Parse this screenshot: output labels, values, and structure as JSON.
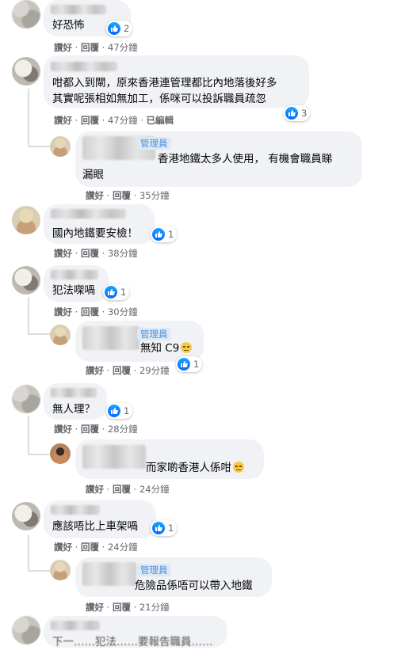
{
  "actions": {
    "like": "讚好",
    "reply": "回覆",
    "edited": "已編輯"
  },
  "admin_badge": "管理員",
  "comments": [
    {
      "text": "好恐怖",
      "likes": "2",
      "time": "47分鐘"
    },
    {
      "text_line1": "咁都入到閘，原來香港連管理都比內地落後好多",
      "text_line2": "其實呢張相如無加工，係咪可以投訴職員疏忽",
      "likes": "3",
      "time": "47分鐘"
    },
    {
      "text_line1": "香港地鐵太多人使用， 有機會職員睇",
      "text_line2": "漏眼",
      "time": "35分鐘"
    },
    {
      "text": "國內地鐵要安檢！",
      "likes": "1",
      "time": "38分鐘"
    },
    {
      "text": "犯法㗎喎",
      "likes": "1",
      "time": "30分鐘"
    },
    {
      "text": "無知 C9",
      "likes": "1",
      "time": "29分鐘"
    },
    {
      "text": "無人理？",
      "likes": "1",
      "time": "28分鐘"
    },
    {
      "text": "而家啲香港人係咁",
      "time": "24分鐘"
    },
    {
      "text": "應該唔比上車架喎",
      "likes": "1",
      "time": "24分鐘"
    },
    {
      "text": "危險品係唔可以帶入地鐵",
      "time": "21分鐘"
    },
    {
      "text": "下一……犯法……要報告職員……"
    }
  ],
  "colors": {
    "bubble": "#f0f2f5",
    "meta": "#65676b",
    "like_blue": "#0866ff",
    "admin_badge_bg": "#dfe9f6",
    "admin_badge_text": "#4b8fd6"
  },
  "icons": {
    "like": "like-thumb-icon",
    "emoji": "grimacing-face-emoji"
  }
}
